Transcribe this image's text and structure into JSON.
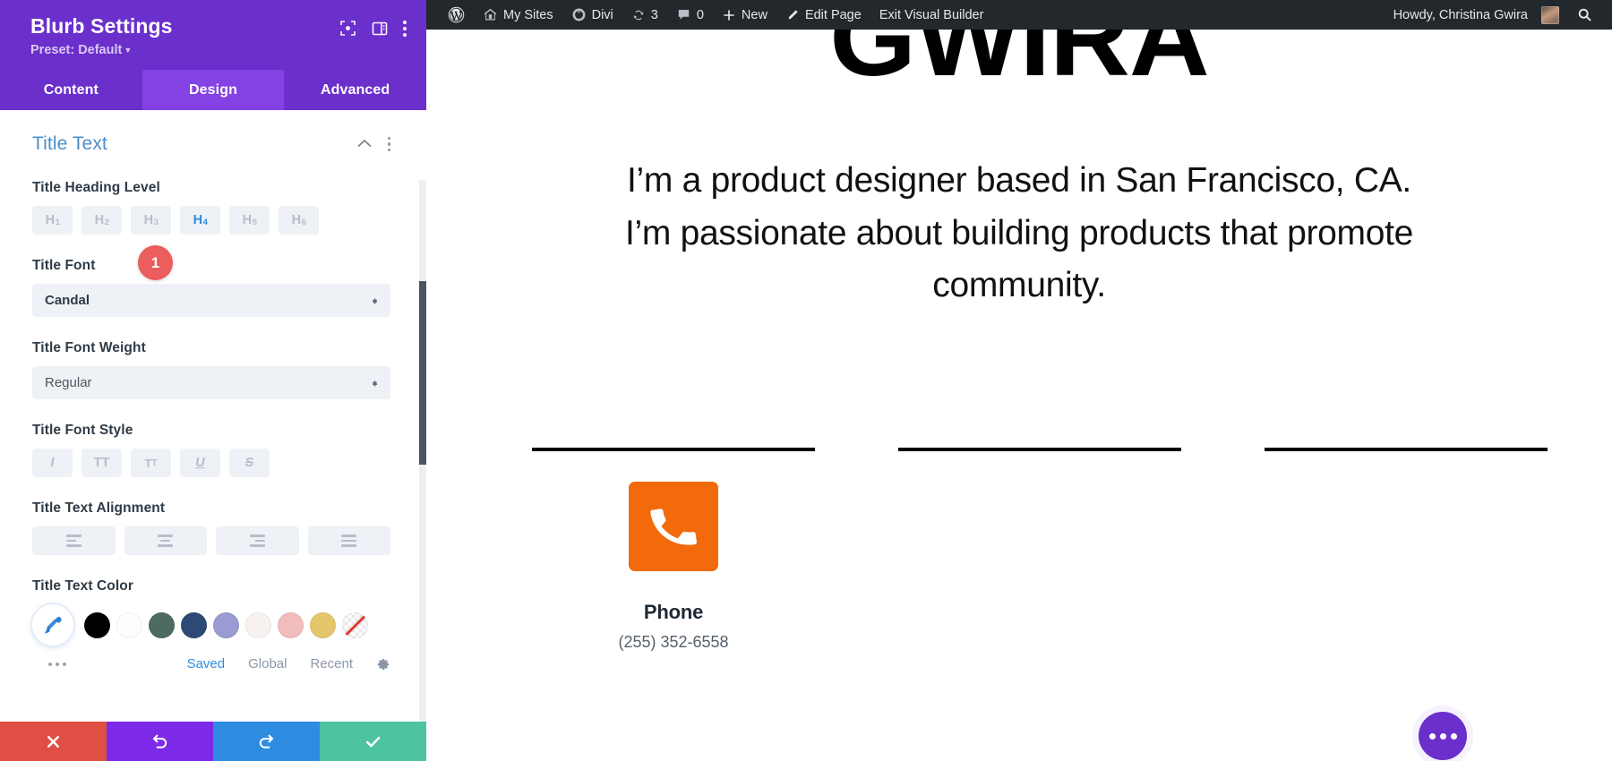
{
  "panel": {
    "title": "Blurb Settings",
    "preset_label": "Preset: Default",
    "icons": {
      "focus": "focus-target-icon",
      "layout": "panel-layout-icon",
      "more": "more-vertical-icon"
    },
    "tabs": [
      {
        "label": "Content",
        "active": false
      },
      {
        "label": "Design",
        "active": true
      },
      {
        "label": "Advanced",
        "active": false
      }
    ],
    "section": {
      "title": "Title Text",
      "collapse_icon": "chevron-up-icon",
      "more_icon": "more-vertical-icon"
    },
    "fields": {
      "heading_level": {
        "label": "Title Heading Level",
        "options": [
          {
            "tag": "H",
            "sub": "1",
            "active": false
          },
          {
            "tag": "H",
            "sub": "2",
            "active": false
          },
          {
            "tag": "H",
            "sub": "3",
            "active": false
          },
          {
            "tag": "H",
            "sub": "4",
            "active": true
          },
          {
            "tag": "H",
            "sub": "5",
            "active": false
          },
          {
            "tag": "H",
            "sub": "6",
            "active": false
          }
        ]
      },
      "title_font": {
        "label": "Title Font",
        "value": "Candal",
        "badge": "1"
      },
      "title_font_weight": {
        "label": "Title Font Weight",
        "value": "Regular"
      },
      "title_font_style": {
        "label": "Title Font Style",
        "options": [
          "I",
          "TT",
          "TT",
          "U",
          "S"
        ]
      },
      "title_text_alignment": {
        "label": "Title Text Alignment",
        "options": [
          "align-left",
          "align-center",
          "align-right",
          "align-justify"
        ]
      },
      "title_text_color": {
        "label": "Title Text Color",
        "picker_icon": "eyedropper-icon",
        "swatches": [
          "#000000",
          "#ffffff",
          "#4d6b5e",
          "#2c4a75",
          "#9b9bd4",
          "#f7f2ef",
          "#f1bcbc",
          "#e5c76b",
          "none"
        ],
        "more_icon": "more-horizontal-icon",
        "links": [
          {
            "label": "Saved",
            "active": true
          },
          {
            "label": "Global",
            "active": false
          },
          {
            "label": "Recent",
            "active": false
          }
        ],
        "settings_icon": "gear-icon"
      }
    },
    "actions": [
      {
        "name": "cancel",
        "icon": "close-icon",
        "color": "#e04f43"
      },
      {
        "name": "undo",
        "icon": "undo-icon",
        "color": "#7d2ae8"
      },
      {
        "name": "redo",
        "icon": "redo-icon",
        "color": "#2d8ce0"
      },
      {
        "name": "save",
        "icon": "check-icon",
        "color": "#4dc3a0"
      }
    ]
  },
  "adminbar": {
    "items": [
      {
        "label": "",
        "icon": "wordpress-logo-icon"
      },
      {
        "label": "My Sites",
        "icon": "sites-icon"
      },
      {
        "label": "Divi",
        "icon": "divi-icon"
      },
      {
        "label": "3",
        "icon": "updates-icon"
      },
      {
        "label": "0",
        "icon": "comment-icon"
      },
      {
        "label": "New",
        "icon": "plus-icon"
      },
      {
        "label": "Edit Page",
        "icon": "pencil-icon"
      },
      {
        "label": "Exit Visual Builder",
        "icon": ""
      }
    ],
    "greeting": "Howdy, Christina Gwira",
    "avatar": "user-avatar",
    "search_icon": "search-icon"
  },
  "page": {
    "hero_word": "GWIRA",
    "hero_paragraph": "I’m a product designer based in San Francisco, CA. I’m passionate about building products that promote community.",
    "blurb": {
      "icon": "phone-icon",
      "icon_bg": "#F26A0B",
      "title": "Phone",
      "text": "(255) 352-6558"
    },
    "fab": {
      "icon": "more-horizontal-icon",
      "color": "#6B2FCB"
    }
  }
}
